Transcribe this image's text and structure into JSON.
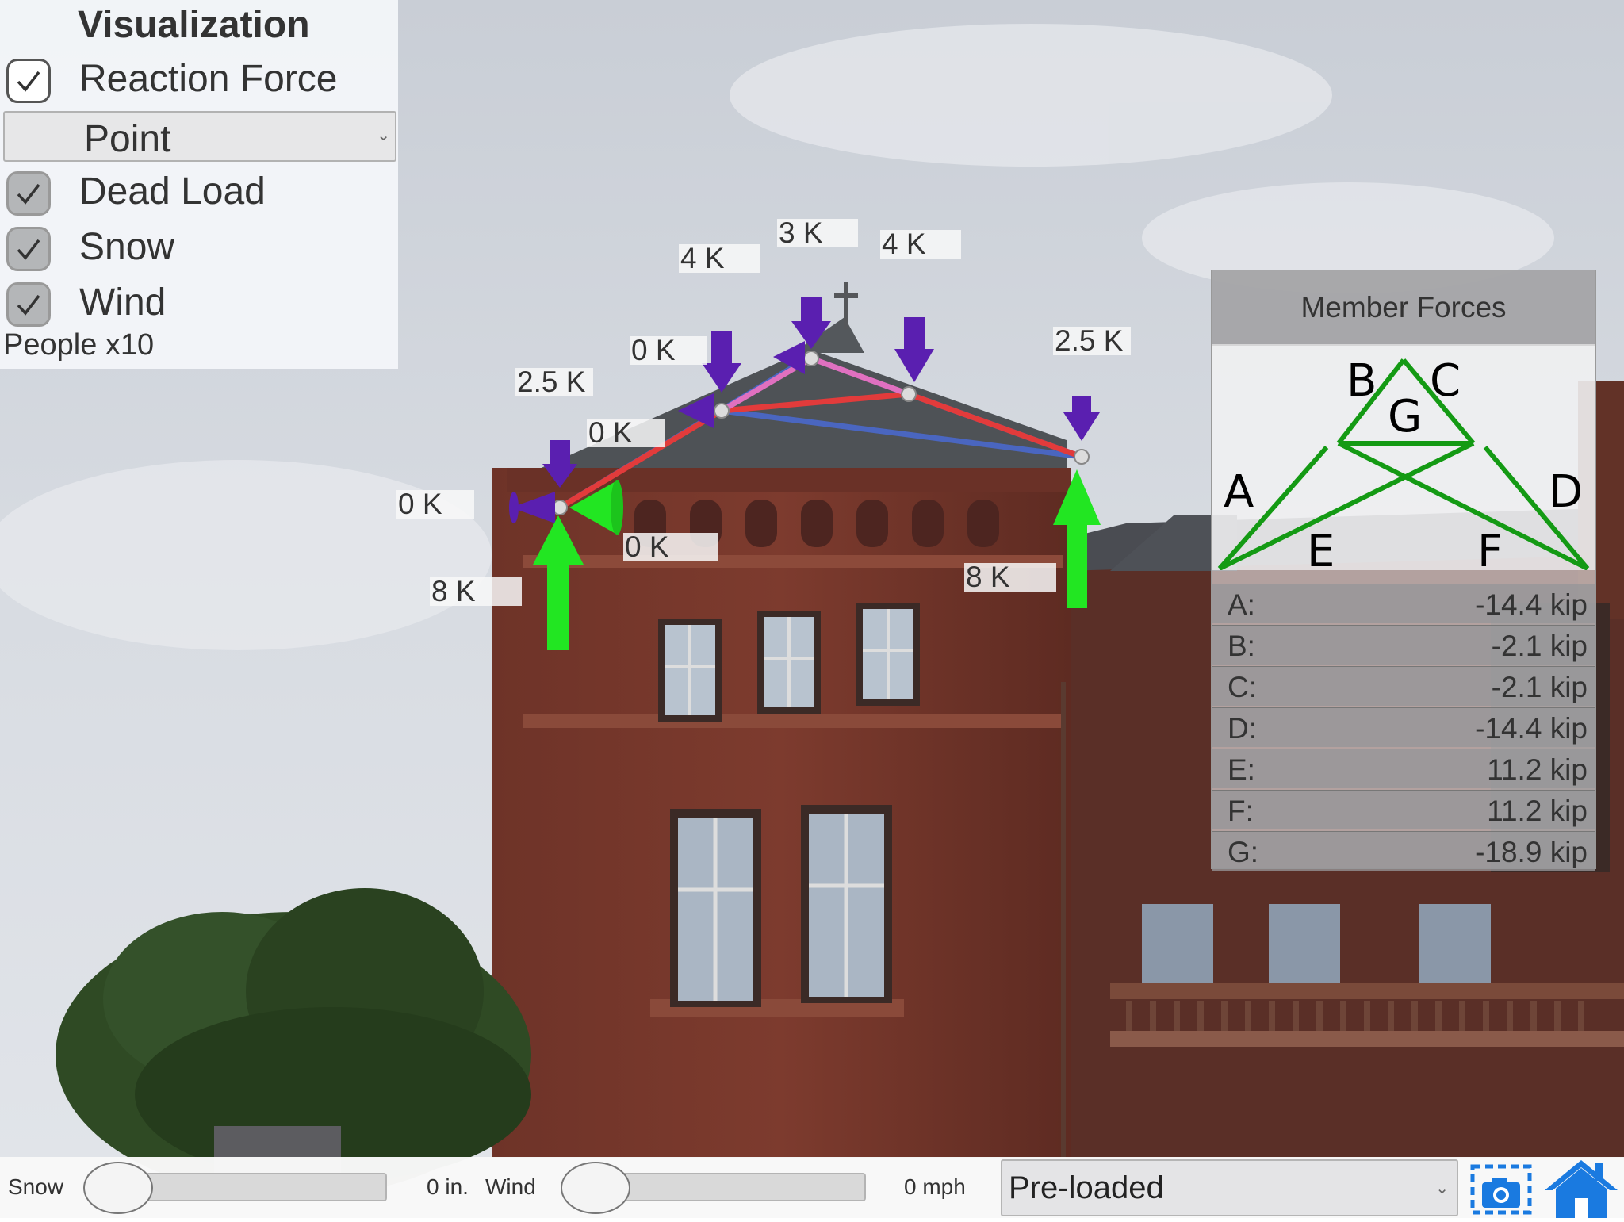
{
  "visualization": {
    "title": "Visualization",
    "reaction_force": {
      "label": "Reaction Force",
      "checked": true
    },
    "reaction_type": {
      "selected": "Point"
    },
    "dead_load": {
      "label": "Dead Load",
      "checked": true
    },
    "snow": {
      "label": "Snow",
      "checked": true
    },
    "wind": {
      "label": "Wind",
      "checked": true
    },
    "people_label": "People x10"
  },
  "load_labels": {
    "left_side": "0 K",
    "left_bottom": "0 K",
    "left_reaction": "8 K",
    "right_reaction": "8 K",
    "node_left_eave": "2.5 K",
    "node_left_wind": "0 K",
    "node_left_mid_wind": "0 K",
    "node_left_mid": "4 K",
    "node_apex": "3 K",
    "node_right_mid": "4 K",
    "node_right_eave": "2.5 K"
  },
  "member_forces": {
    "title": "Member Forces",
    "diagram_labels": {
      "A": "A",
      "B": "B",
      "C": "C",
      "D": "D",
      "E": "E",
      "F": "F",
      "G": "G"
    },
    "rows": [
      {
        "name": "A:",
        "value": "-14.4 kip"
      },
      {
        "name": "B:",
        "value": "-2.1 kip"
      },
      {
        "name": "C:",
        "value": "-2.1 kip"
      },
      {
        "name": "D:",
        "value": "-14.4 kip"
      },
      {
        "name": "E:",
        "value": "11.2 kip"
      },
      {
        "name": "F:",
        "value": "11.2 kip"
      },
      {
        "name": "G:",
        "value": "-18.9 kip"
      }
    ]
  },
  "bottom_bar": {
    "snow_label": "Snow",
    "snow_value": "0 in.",
    "wind_label": "Wind",
    "wind_value": "0 mph",
    "preset": {
      "selected": "Pre-loaded"
    }
  },
  "icons": {
    "camera": "camera-icon",
    "home": "home-icon"
  },
  "colors": {
    "truss_compression": "#e23b3b",
    "truss_tension": "#4a66c0",
    "truss_top": "#e070c0",
    "reaction_arrow": "#22e622",
    "load_arrow": "#5a1fb0",
    "diagram_line": "#149a14",
    "home_blue": "#1a7ae0"
  }
}
